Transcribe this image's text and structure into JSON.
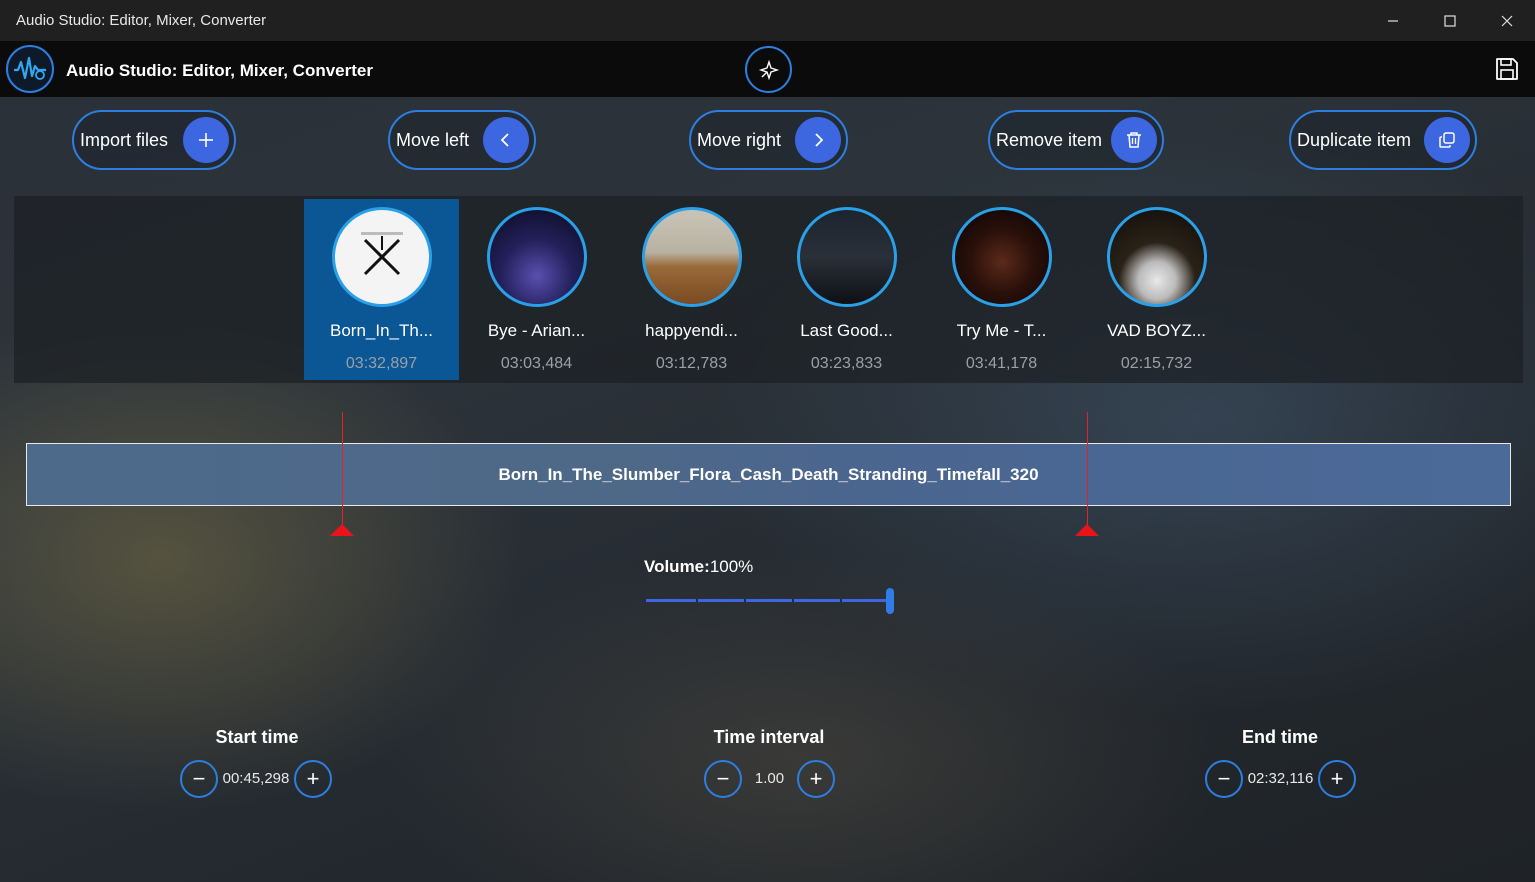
{
  "window": {
    "title": "Audio Studio: Editor, Mixer, Converter",
    "minimize_icon": "minimize-icon",
    "maximize_icon": "maximize-icon",
    "close_icon": "close-icon"
  },
  "header": {
    "app_title": "Audio Studio: Editor, Mixer, Converter",
    "logo_icon": "audio-studio-logo",
    "center_icon": "magic-wand-icon",
    "save_icon": "save-icon"
  },
  "toolbar": {
    "import_label": "Import files",
    "move_left_label": "Move left",
    "move_right_label": "Move right",
    "remove_label": "Remove item",
    "duplicate_label": "Duplicate item"
  },
  "tracks": [
    {
      "name": "Born_In_Th...",
      "duration": "03:32,897",
      "selected": true
    },
    {
      "name": "Bye - Arian...",
      "duration": "03:03,484",
      "selected": false
    },
    {
      "name": "happyendi...",
      "duration": "03:12,783",
      "selected": false
    },
    {
      "name": "Last Good...",
      "duration": "03:23,833",
      "selected": false
    },
    {
      "name": "Try Me - T...",
      "duration": "03:41,178",
      "selected": false
    },
    {
      "name": "VAD BOYZ...",
      "duration": "02:15,732",
      "selected": false
    }
  ],
  "waveform": {
    "file_name": "Born_In_The_Slumber_Flora_Cash_Death_Stranding_Timefall_320"
  },
  "volume": {
    "label": "Volume:",
    "value": "100%",
    "level": 1.0
  },
  "time_controls": {
    "start": {
      "label": "Start time",
      "value": "00:45,298"
    },
    "interval": {
      "label": "Time interval",
      "value": "1.00"
    },
    "end": {
      "label": "End time",
      "value": "02:32,116"
    }
  },
  "colors": {
    "accent": "#2c7fe0",
    "button_fill": "#3d67e0",
    "selected_track": "#0b5694",
    "marker": "#e8141a"
  }
}
